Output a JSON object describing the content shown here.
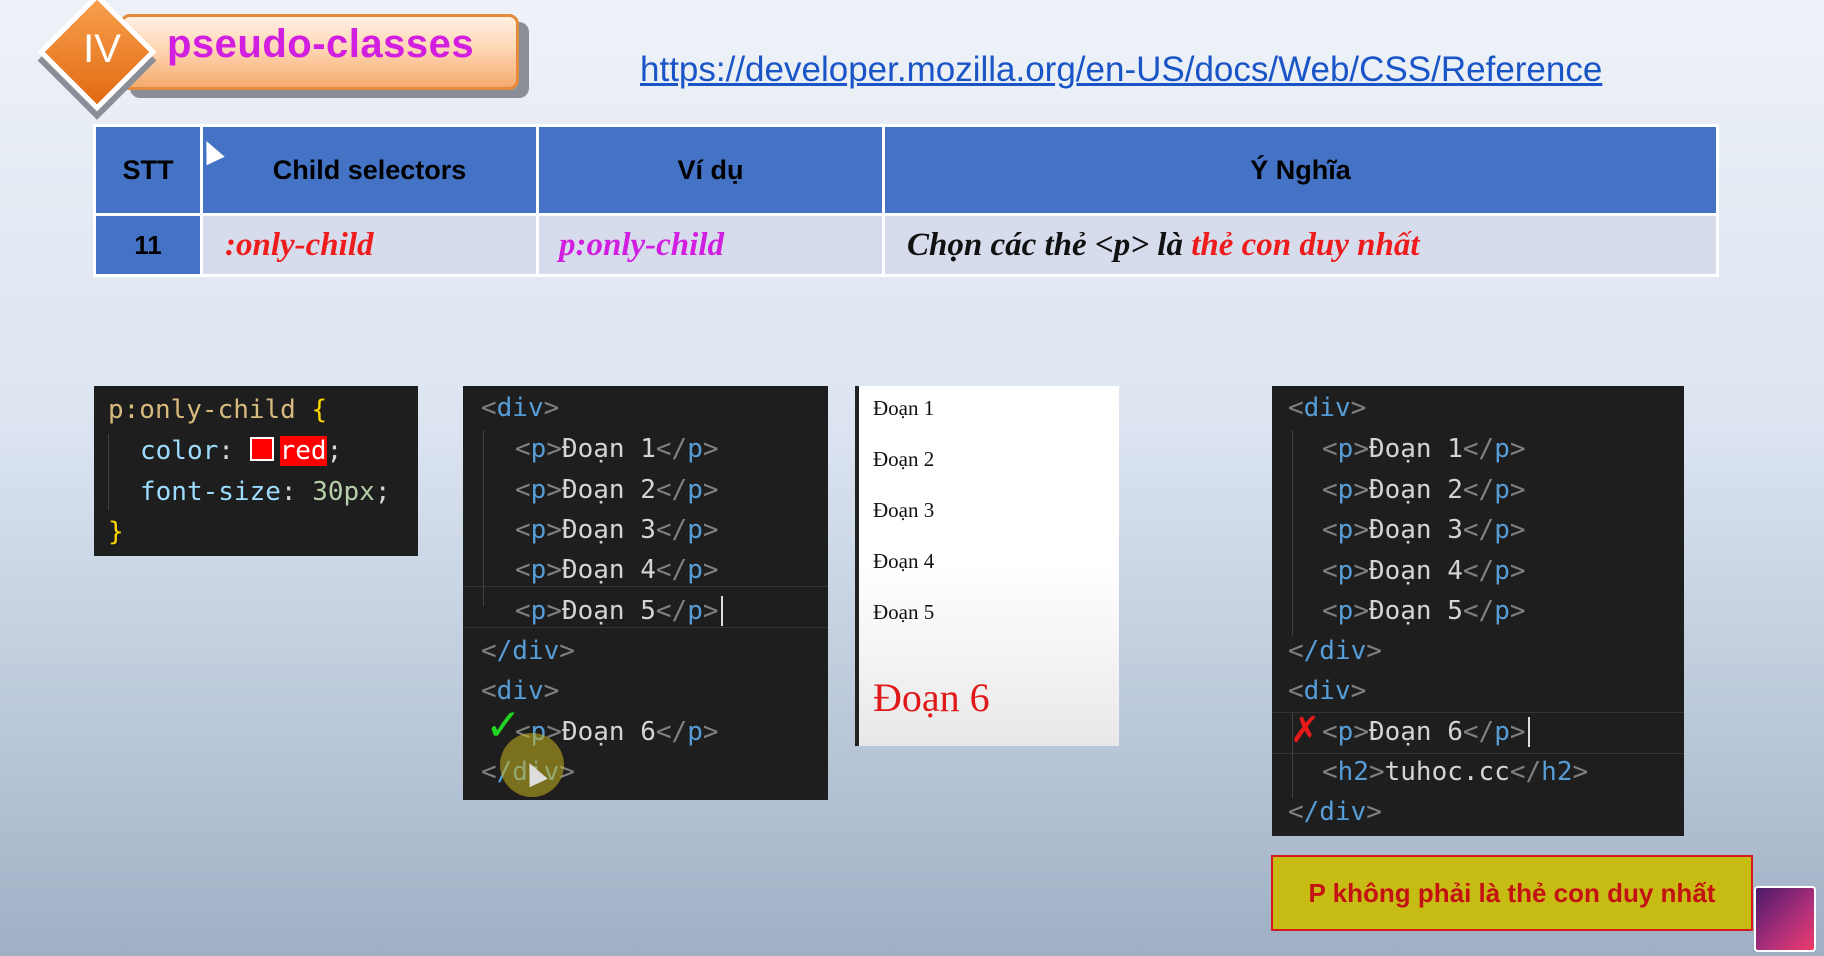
{
  "header": {
    "section_number": "IV",
    "title": "pseudo-classes",
    "reference_url": "https://developer.mozilla.org/en-US/docs/Web/CSS/Reference"
  },
  "table": {
    "headers": [
      "STT",
      "Child selectors",
      "Ví dụ",
      "Ý Nghĩa"
    ],
    "row": {
      "stt": "11",
      "selector": ":only-child",
      "example": "p:only-child",
      "meaning_prefix": "Chọn các thẻ <p> là ",
      "meaning_highlight": "thẻ con duy nhất"
    }
  },
  "css_code": {
    "selector": "p:only-child",
    "open_brace": "{",
    "prop1": "color",
    "val1": "red",
    "prop2": "font-size",
    "val2": "30px",
    "close_brace": "}"
  },
  "html_code_1": {
    "div_open": "div",
    "div_close": "/div",
    "p_items": [
      "Đoạn 1",
      "Đoạn 2",
      "Đoạn 3",
      "Đoạn 4",
      "Đoạn 5"
    ],
    "single_p": "Đoạn 6",
    "checkmark": "✓"
  },
  "preview": {
    "items": [
      "Đoạn 1",
      "Đoạn 2",
      "Đoạn 3",
      "Đoạn 4",
      "Đoạn 5"
    ],
    "big_item": "Đoạn 6",
    "big_color": "#e01818"
  },
  "html_code_2": {
    "p_items": [
      "Đoạn 1",
      "Đoạn 2",
      "Đoạn 3",
      "Đoạn 4",
      "Đoạn 5"
    ],
    "p6": "Đoạn 6",
    "h2_text": "tuhoc.cc",
    "cross": "✗"
  },
  "note": {
    "text": "P không phải là thẻ con duy nhất"
  },
  "colors": {
    "header_blue": "#4472c4",
    "cell_bg": "#d6dcec",
    "accent_red": "#ee1c1c",
    "accent_magenta": "#d21ee0",
    "note_bg": "#c7bc14"
  }
}
